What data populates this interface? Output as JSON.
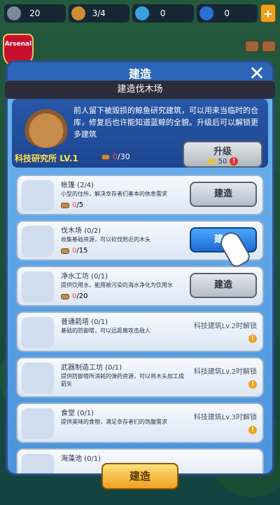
{
  "resources": [
    {
      "icon": "gear-icon",
      "value": "20"
    },
    {
      "icon": "person-icon",
      "value": "3/4"
    },
    {
      "icon": "water-drop-icon",
      "value": "0"
    },
    {
      "icon": "diamond-icon",
      "value": "0"
    }
  ],
  "team_badge": "Arsenal",
  "dialog": {
    "title": "建造",
    "tooltip": "建造伐木场",
    "info": {
      "desc": "前人留下被毁损的鲸鱼研究建筑，可以用来当临时的仓库，修复后也许能知道蓝鲸的全貌。升级后可以解锁更多建筑",
      "level": "科技研究所 LV.1",
      "cost_have": "0",
      "cost_need": "/30",
      "upgrade_label": "升级",
      "upgrade_cost": "50"
    },
    "items": [
      {
        "name": "帐篷 (2/4)",
        "desc": "小型的住所，解决幸存者们基本的休息需求",
        "cost_have": "0",
        "cost_need": "/5",
        "action": "建造"
      },
      {
        "name": "伐木场 (0/2)",
        "desc": "收集基础资源，可以砍伐附近的木头",
        "cost_have": "0",
        "cost_need": "/15",
        "action": "建造"
      },
      {
        "name": "净水工坊 (0/1)",
        "desc": "提供饮用水，能用被污染的海水净化为饮用水",
        "cost_have": "0",
        "cost_need": "/20",
        "action": "建造"
      },
      {
        "name": "普通箭塔 (0/1)",
        "desc": "基础的防御塔，可以远距离攻击敌人",
        "lock": "科技建筑Lv.2时解锁"
      },
      {
        "name": "武器制造工坊 (0/1)",
        "desc": "提供防御塔所消耗的弹药资源，可以将木头加工成箭矢",
        "lock": "科技建筑Lv.2时解锁"
      },
      {
        "name": "食堂 (0/1)",
        "desc": "提供美味的食物，满足幸存者们的饱腹需求",
        "lock": "科技建筑Lv.3时解锁"
      },
      {
        "name": "海藻池 (0/1)",
        "desc": "",
        "lock": ""
      }
    ],
    "bottom_label": "建造"
  }
}
